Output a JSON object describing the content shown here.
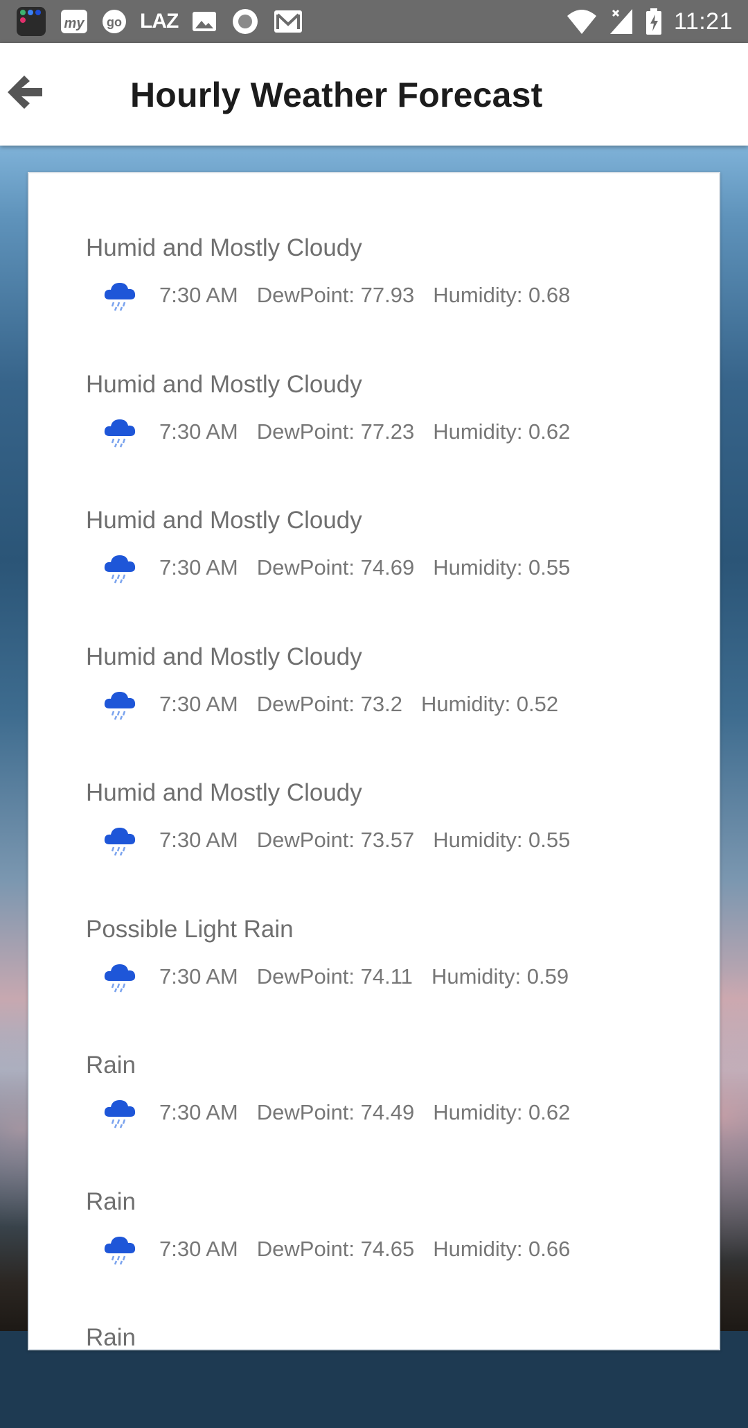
{
  "status_bar": {
    "time": "11:21",
    "left_icons": [
      "app-folder-icon",
      "mytaxi-icon",
      "go-icon",
      "lazada-icon",
      "gallery-icon",
      "record-icon",
      "gmail-icon"
    ],
    "right_icons": [
      "wifi-icon",
      "signal-icon",
      "battery-charging-icon"
    ],
    "laz_label": "LAZ",
    "go_label": "go",
    "my_label": "my"
  },
  "app_bar": {
    "title": "Hourly Weather Forecast",
    "back_icon": "back-arrow-icon"
  },
  "colors": {
    "icon_blue": "#1e56d8",
    "text_gray": "#6f6f6f",
    "status_bar": "#6b6b6b"
  },
  "forecast": [
    {
      "summary": "Humid and Mostly Cloudy",
      "time": "7:30 AM",
      "dewpoint": "DewPoint: 77.93",
      "humidity": "Humidity: 0.68",
      "icon": "rain-cloud-icon"
    },
    {
      "summary": "Humid and Mostly Cloudy",
      "time": "7:30 AM",
      "dewpoint": "DewPoint: 77.23",
      "humidity": "Humidity: 0.62",
      "icon": "rain-cloud-icon"
    },
    {
      "summary": "Humid and Mostly Cloudy",
      "time": "7:30 AM",
      "dewpoint": "DewPoint: 74.69",
      "humidity": "Humidity: 0.55",
      "icon": "rain-cloud-icon"
    },
    {
      "summary": "Humid and Mostly Cloudy",
      "time": "7:30 AM",
      "dewpoint": "DewPoint: 73.2",
      "humidity": "Humidity: 0.52",
      "icon": "rain-cloud-icon"
    },
    {
      "summary": "Humid and Mostly Cloudy",
      "time": "7:30 AM",
      "dewpoint": "DewPoint: 73.57",
      "humidity": "Humidity: 0.55",
      "icon": "rain-cloud-icon"
    },
    {
      "summary": "Possible Light Rain",
      "time": "7:30 AM",
      "dewpoint": "DewPoint: 74.11",
      "humidity": "Humidity: 0.59",
      "icon": "rain-cloud-icon"
    },
    {
      "summary": "Rain",
      "time": "7:30 AM",
      "dewpoint": "DewPoint: 74.49",
      "humidity": "Humidity: 0.62",
      "icon": "rain-cloud-icon"
    },
    {
      "summary": "Rain",
      "time": "7:30 AM",
      "dewpoint": "DewPoint: 74.65",
      "humidity": "Humidity: 0.66",
      "icon": "rain-cloud-icon"
    },
    {
      "summary": "Rain",
      "time": "",
      "dewpoint": "",
      "humidity": "",
      "icon": "rain-cloud-icon"
    }
  ]
}
